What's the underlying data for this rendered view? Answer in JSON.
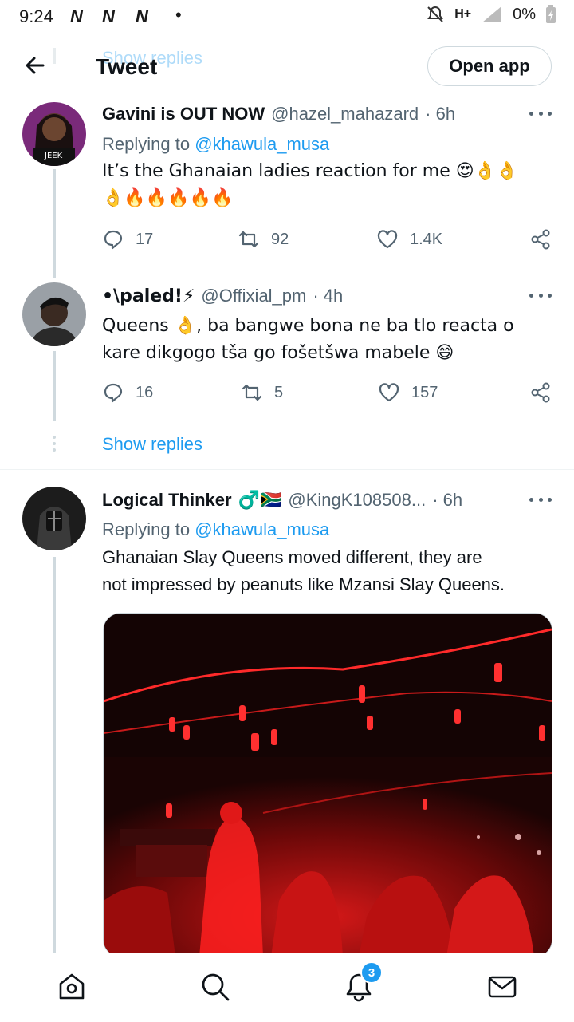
{
  "status_bar": {
    "time": "9:24",
    "carriers": [
      "N",
      "N",
      "N"
    ],
    "network": "H+",
    "battery": "0%"
  },
  "header": {
    "title": "Tweet",
    "ghost_text": "Show replies",
    "open_app_label": "Open app"
  },
  "tweets": [
    {
      "name": "Gavini is OUT NOW",
      "handle": "@hazel_mahazard",
      "time": "· 6h",
      "replying_prefix": "Replying to ",
      "replying_to": "@khawula_musa",
      "text_line1": "It’s the Ghanaian ladies reaction for me 😍👌👌",
      "text_line2": "👌🔥🔥🔥🔥🔥",
      "replies": "17",
      "retweets": "92",
      "likes": "1.4K"
    },
    {
      "name": "•\\paled!⚡",
      "handle": "@Offixial_pm",
      "time": "· 4h",
      "text_line1": "Queens 👌, ba bangwe bona ne ba tlo reacta o",
      "text_line2": "kare dikgogo tša go fošetšwa mabele 😄",
      "replies": "16",
      "retweets": "5",
      "likes": "157"
    },
    {
      "name": "Logical Thinker",
      "badges": "♂️🇿🇦",
      "handle": "@KingK108508...",
      "time": "· 6h",
      "replying_prefix": "Replying to ",
      "replying_to": "@khawula_musa",
      "text_line1": "Ghanaian Slay Queens moved different, they are",
      "text_line2": "not impressed by peanuts like Mzansi Slay Queens."
    }
  ],
  "show_replies_label": "Show replies",
  "bottom_nav": {
    "notifications_badge": "3"
  },
  "colors": {
    "accent": "#1d9bf0",
    "secondary_text": "#536471",
    "primary_text": "#0f1419",
    "divider": "#cfd9de"
  }
}
